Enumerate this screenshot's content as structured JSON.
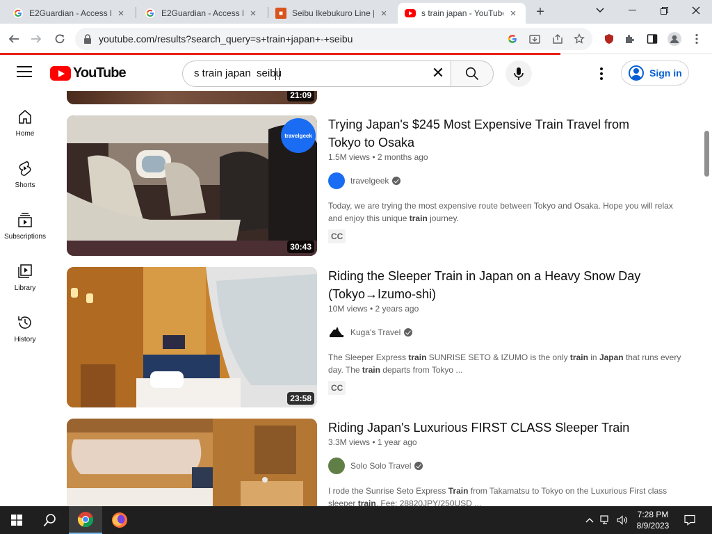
{
  "browser": {
    "tabs": [
      {
        "title": "E2Guardian - Access De"
      },
      {
        "title": "E2Guardian - Access De"
      },
      {
        "title": "Seibu Ikebukuro Line | "
      },
      {
        "title": "s train japan - YouTube"
      }
    ],
    "url": "youtube.com/results?search_query=s+train+japan+-+seibu",
    "extension_badge": "36"
  },
  "youtube": {
    "logo_text": "YouTube",
    "search_query": "s train japan  seibu",
    "sign_in": "Sign in",
    "guide": [
      {
        "label": "Home"
      },
      {
        "label": "Shorts"
      },
      {
        "label": "Subscriptions"
      },
      {
        "label": "Library"
      },
      {
        "label": "History"
      }
    ],
    "partial_top_duration": "21:09",
    "results": [
      {
        "title": "Trying Japan's $245 Most Expensive Train Travel from Tokyo to Osaka",
        "meta": "1.5M views • 2 months ago",
        "channel": "travelgeek",
        "thumb_badge": "travelgeek",
        "desc_parts": [
          "Today, we are trying the most expensive route between Tokyo and Osaka. Hope you will relax and enjoy this unique ",
          "train",
          " journey."
        ],
        "cc": "CC",
        "duration": "30:43"
      },
      {
        "title": "Riding the Sleeper Train in Japan on a Heavy Snow Day (Tokyo→Izumo-shi)",
        "meta": "10M views • 2 years ago",
        "channel": "Kuga's Travel",
        "desc_parts": [
          "The Sleeper Express ",
          "train",
          " SUNRISE SETO & IZUMO is the only ",
          "train",
          " in ",
          "Japan",
          " that runs every day. The ",
          "train",
          " departs from Tokyo ..."
        ],
        "cc": "CC",
        "duration": "23:58"
      },
      {
        "title": "Riding Japan's Luxurious FIRST CLASS Sleeper Train",
        "meta": "3.3M views • 1 year ago",
        "channel": "Solo Solo Travel",
        "desc_parts": [
          "I rode the Sunrise Seto Express ",
          "Train",
          " from Takamatsu to Tokyo on the Luxurious First class sleeper ",
          "train",
          ". Fee: 28820JPY/250USD ..."
        ]
      }
    ]
  },
  "taskbar": {
    "time": "7:28 PM",
    "date": "8/9/2023"
  }
}
